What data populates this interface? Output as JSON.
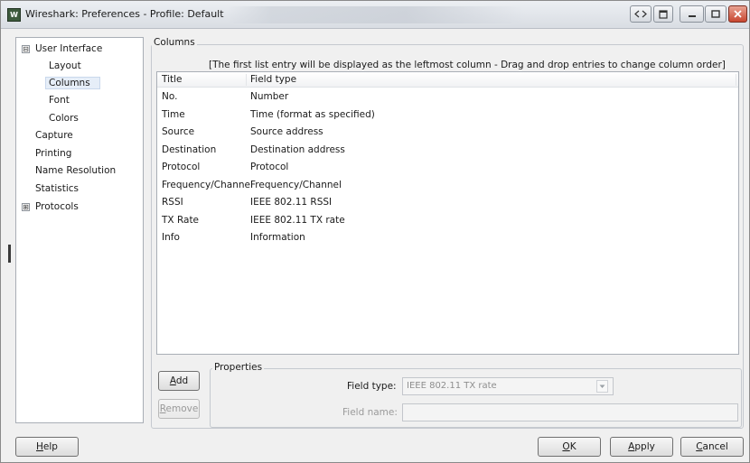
{
  "window": {
    "title": "Wireshark: Preferences - Profile: Default",
    "app_icon_text": "W",
    "colors": {
      "title_bar": "#dde1e7",
      "selection": "#e6eef8",
      "close_button": "#c8462f"
    }
  },
  "title_buttons": {
    "icons": [
      "nav-arrows-icon",
      "restore-doc-icon",
      "minimize-icon",
      "maximize-icon",
      "close-icon"
    ]
  },
  "sidebar": {
    "items": [
      {
        "label": "User Interface",
        "expander": "⊟"
      },
      {
        "label": "Layout"
      },
      {
        "label": "Columns",
        "selected": true
      },
      {
        "label": "Font"
      },
      {
        "label": "Colors"
      },
      {
        "label": "Capture"
      },
      {
        "label": "Printing"
      },
      {
        "label": "Name Resolution"
      },
      {
        "label": "Statistics"
      },
      {
        "label": "Protocols",
        "expander": "⊞"
      }
    ]
  },
  "columns_group": {
    "label": "Columns",
    "hint": "[The first list entry will be displayed as the leftmost column - Drag and drop entries to change column order]",
    "headers": [
      "Title",
      "Field type"
    ],
    "rows": [
      [
        "No.",
        "Number"
      ],
      [
        "Time",
        "Time (format as specified)"
      ],
      [
        "Source",
        "Source address"
      ],
      [
        "Destination",
        "Destination address"
      ],
      [
        "Protocol",
        "Protocol"
      ],
      [
        "Frequency/Channel",
        "Frequency/Channel"
      ],
      [
        "RSSI",
        "IEEE 802.11 RSSI"
      ],
      [
        "TX Rate",
        "IEEE 802.11 TX rate"
      ],
      [
        "Info",
        "Information"
      ]
    ]
  },
  "list_buttons": {
    "add": {
      "mnemonic": "A",
      "rest": "dd"
    },
    "remove": {
      "mnemonic": "R",
      "rest": "emove"
    }
  },
  "properties": {
    "label": "Properties",
    "field_type_label": "Field type:",
    "field_type_value": "IEEE 802.11 TX rate",
    "field_name_label": "Field name:",
    "field_name_value": ""
  },
  "footer": {
    "help": {
      "mnemonic": "H",
      "rest": "elp"
    },
    "ok": {
      "mnemonic": "O",
      "rest": "K"
    },
    "apply": {
      "mnemonic": "A",
      "rest": "pply"
    },
    "cancel": {
      "mnemonic": "C",
      "rest": "ancel"
    }
  }
}
